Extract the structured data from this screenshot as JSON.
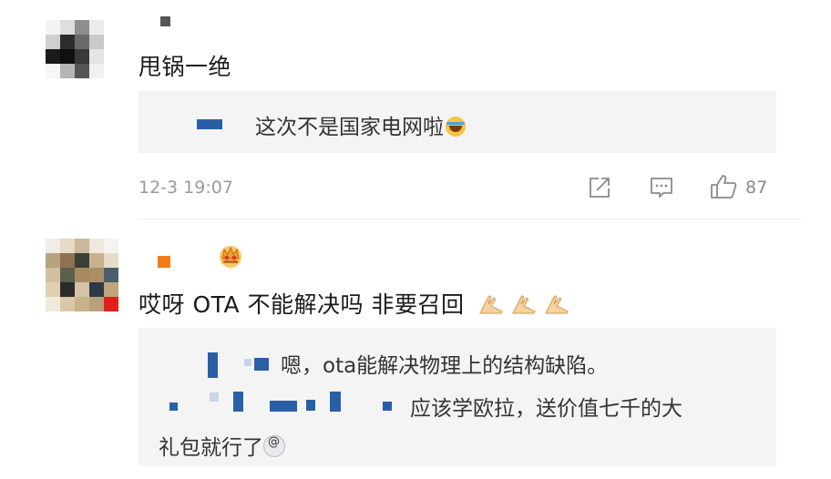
{
  "comment1": {
    "text": "甩锅一绝",
    "reply_text": "这次不是国家电网啦",
    "reply_emoji": "laughing-tears-emoji",
    "timestamp": "12-3 19:07",
    "like_count": "87"
  },
  "comment2": {
    "text": "哎呀 OTA 不能解决吗 非要召回",
    "trailing_emojis": [
      "clapping-hands-emoji",
      "clapping-hands-emoji",
      "clapping-hands-emoji"
    ],
    "badge": "crown-badge-icon",
    "reply1_text": "嗯，ota能解决物理上的结构缺陷。",
    "reply2_text_line1": "应该学欧拉，送价值七千的大",
    "reply2_text_line2": "礼包就行了",
    "reply2_emoji": "dizzy-face-emoji"
  },
  "colors": {
    "text": "#1a1a1a",
    "meta": "#9a9a9a",
    "reply_bg": "#f4f4f5",
    "blue_block": "#2a5fa8",
    "orange_block": "#f07d1a"
  }
}
